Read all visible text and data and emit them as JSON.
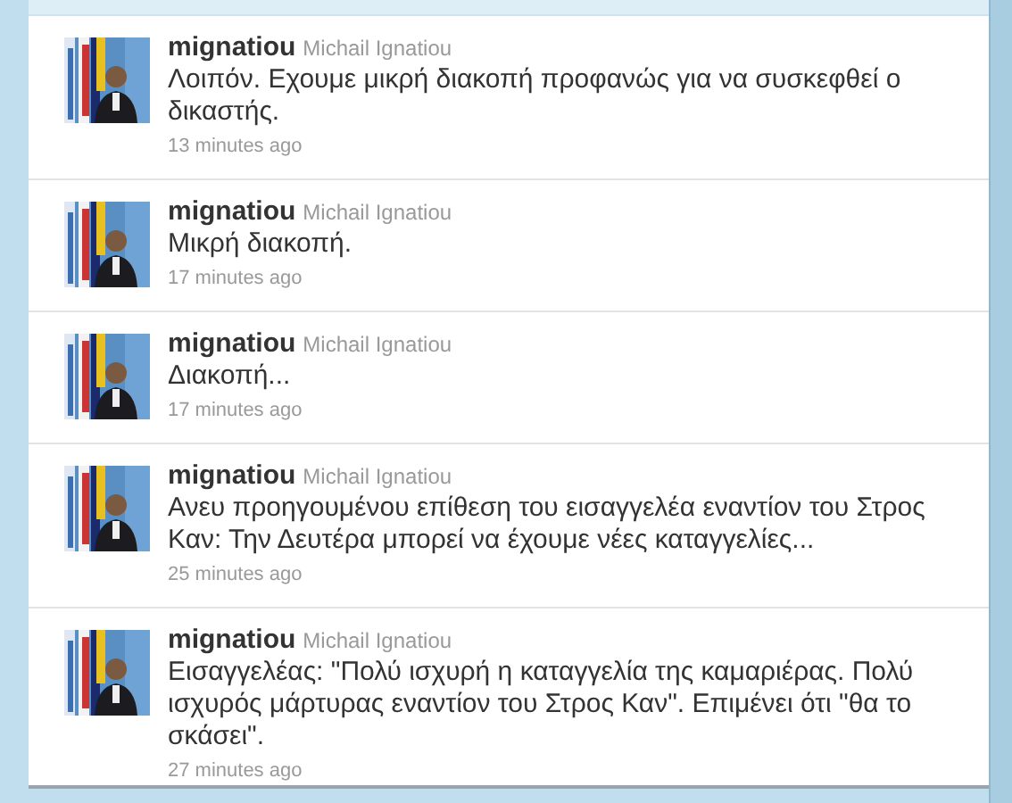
{
  "tweets": [
    {
      "username": "mignatiou",
      "full_name": "Michail Ignatiou",
      "text": "Λοιπόν. Εχουμε μικρή διακοπή προφανώς για να συσκεφθεί ο δικαστής.",
      "time": "13 minutes ago"
    },
    {
      "username": "mignatiou",
      "full_name": "Michail Ignatiou",
      "text": "Μικρή διακοπή.",
      "time": "17 minutes ago"
    },
    {
      "username": "mignatiou",
      "full_name": "Michail Ignatiou",
      "text": "Διακοπή...",
      "time": "17 minutes ago"
    },
    {
      "username": "mignatiou",
      "full_name": "Michail Ignatiou",
      "text": "Ανευ προηγουμένου επίθεση του εισαγγελέα εναντίον του Στρος Καν: Την Δευτέρα μπορεί να έχουμε νέες καταγγελίες...",
      "time": "25 minutes ago"
    },
    {
      "username": "mignatiou",
      "full_name": "Michail Ignatiou",
      "text": "Εισαγγελέας: \"Πολύ ισχυρή η καταγγελία της καμαριέρας. Πολύ ισχυρός μάρτυρας εναντίον του Στρος Καν\". Επιμένει ότι \"θα το σκάσει\".",
      "time": "27 minutes ago"
    }
  ]
}
